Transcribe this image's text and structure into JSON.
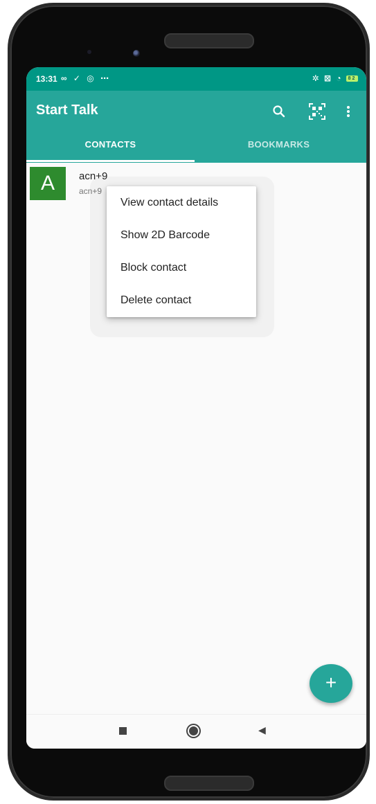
{
  "status_bar": {
    "time": "13:31",
    "left_icons": "∞ ✓ ◎ ⋯",
    "right_icons": "✲ ⊠ ◔",
    "battery": "82"
  },
  "app_bar": {
    "title": "Start Talk",
    "search_icon": "search-icon",
    "qr_icon": "qr-code-icon",
    "more_icon": "more-vert-icon",
    "color": "#26a69a"
  },
  "tabs": [
    {
      "label": "CONTACTS",
      "selected": true
    },
    {
      "label": "BOOKMARKS",
      "selected": false
    }
  ],
  "contacts": [
    {
      "initial": "A",
      "name": "acn+9",
      "subtitle": "acn+9",
      "avatar_color": "#2e8b2e"
    }
  ],
  "context_menu": {
    "items": [
      "View contact details",
      "Show 2D Barcode",
      "Block contact",
      "Delete contact"
    ]
  },
  "fab": {
    "label": "+",
    "icon": "add-icon"
  },
  "nav_bar": {
    "recents_icon": "recents-square-icon",
    "home_icon": "home-circle-icon",
    "back_icon": "back-triangle-icon",
    "back_glyph": "◀"
  }
}
